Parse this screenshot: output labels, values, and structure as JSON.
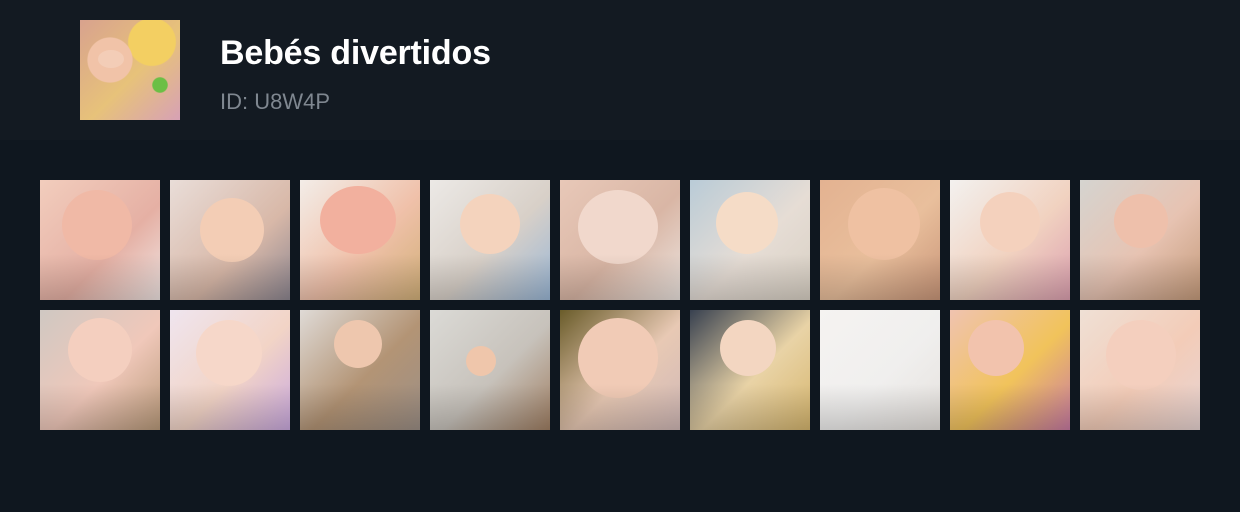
{
  "header": {
    "title": "Bebés divertidos",
    "subtitle": "ID: U8W4P"
  },
  "grid": {
    "items": [
      {
        "bg": "linear-gradient(135deg,#f2cdbd,#e5b0a4 60%,#f0e5e3)",
        "face": "#f0b9a6"
      },
      {
        "bg": "linear-gradient(135deg,#e9ddd8,#d8b8a8 60%,#8e8791)",
        "face": "#f3cdb5"
      },
      {
        "bg": "linear-gradient(135deg,#f3ede8,#f0c1aa 55%,#d2b079)",
        "face": "#f2b09e"
      },
      {
        "bg": "linear-gradient(135deg,#ece9e6,#d8d0c8 55%,#9ab7d6)",
        "face": "#f4d3bd"
      },
      {
        "bg": "linear-gradient(135deg,#e8c8b8,#d9b6a5 55%,#ece4df)",
        "face": "#f1d8cc"
      },
      {
        "bg": "linear-gradient(135deg,#b9cbd7,#e6ddd5 55%,#d8d0c4)",
        "face": "#f5dcc7"
      },
      {
        "bg": "linear-gradient(135deg,#e3b291,#e9bf9c 55%,#c99679)",
        "face": "#efc1a2"
      },
      {
        "bg": "linear-gradient(135deg,#f3f1ef,#f1d2c0 55%,#dca0b0)",
        "face": "#f4d1bd"
      },
      {
        "bg": "linear-gradient(135deg,#d5d4d0,#e7c3b2 55%,#c59b7b)",
        "face": "#eec0ab"
      },
      {
        "bg": "linear-gradient(135deg,#cfc8c2,#f0c8ba 55%,#b99a7a)",
        "face": "#f4cfbf"
      },
      {
        "bg": "linear-gradient(135deg,#efe5ef,#f2d4c6 55%,#caa9df)",
        "face": "#f6d7c9"
      },
      {
        "bg": "linear-gradient(135deg,#dfdad6,#b39475 55%,#9c8f86)",
        "face": "#eec7ae"
      },
      {
        "bg": "linear-gradient(135deg,#dbdad6,#c7c2bb 55%,#a07f63)",
        "face": "#efc6ab"
      },
      {
        "bg": "linear-gradient(135deg,#6a5c2a,#e8c9b4 55%,#d0b8b6)",
        "face": "#f1cbb6"
      },
      {
        "bg": "linear-gradient(135deg,#384150,#e9d3a6 55%,#d6b66e)",
        "face": "#f3d6c1"
      },
      {
        "bg": "linear-gradient(135deg,#f5f3f1,#f0efee 55%,#e6e2de)",
        "face": "#f0efee"
      },
      {
        "bg": "linear-gradient(135deg,#f0c3b0,#f1c35b 55%,#c87aa3)",
        "face": "#f2c3ad"
      },
      {
        "bg": "linear-gradient(135deg,#efe0d5,#f3ccb8 55%,#e8d4d2)",
        "face": "#f4cfbe"
      }
    ]
  }
}
